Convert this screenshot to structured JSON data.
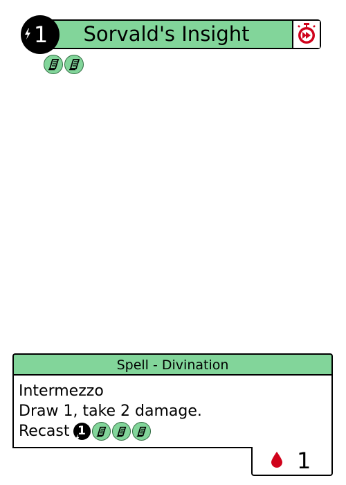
{
  "card": {
    "title": "Sorvald's Insight",
    "cost": "1",
    "cost_icon": "lightning-bolt-icon",
    "speed_icon": "instant-stopwatch-icon",
    "requirement_icons": [
      "spellbook-token-icon",
      "spellbook-token-icon"
    ],
    "type_line": "Spell - Divination",
    "rules_text": {
      "line1": "Intermezzo",
      "line2": "Draw 1, take 2 damage.",
      "recast_label": "Recast",
      "recast_cost": "1",
      "recast_tokens": [
        "spellbook-token-icon",
        "spellbook-token-icon",
        "spellbook-token-icon"
      ]
    },
    "health_icon": "blood-drop-icon",
    "health_value": "1",
    "colors": {
      "accent": "#82d59a",
      "danger": "#d0021b",
      "ink": "#000000"
    }
  }
}
